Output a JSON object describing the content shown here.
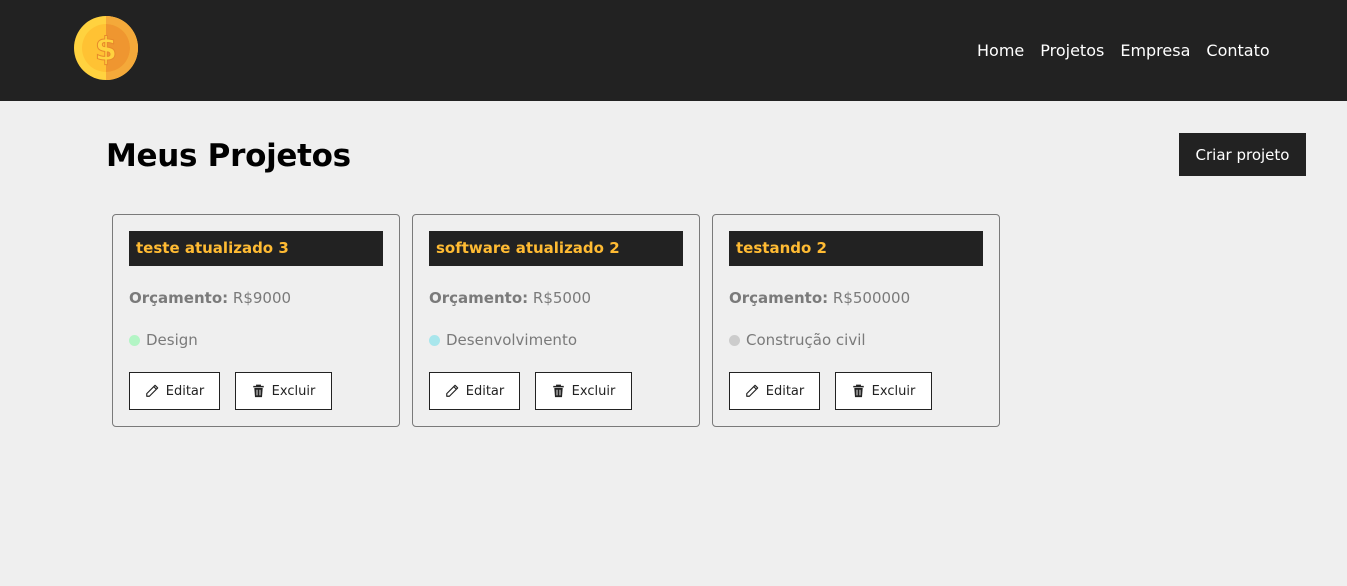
{
  "brand": {
    "logo_icon": "dollar-coin-icon"
  },
  "nav": {
    "items": [
      "Home",
      "Projetos",
      "Empresa",
      "Contato"
    ]
  },
  "main": {
    "title": "Meus Projetos",
    "create_button": "Criar projeto"
  },
  "colors": {
    "dark": "#222222",
    "title_accent": "#ffbb33",
    "text_muted": "#7a7a7a"
  },
  "projects": [
    {
      "name": "teste atualizado 3",
      "budget_label": "Orçamento:",
      "budget": "R$9000",
      "category": "Design",
      "category_color": "#b3f5c5",
      "edit_label": "Editar",
      "delete_label": "Excluir"
    },
    {
      "name": "software atualizado 2",
      "budget_label": "Orçamento:",
      "budget": "R$5000",
      "category": "Desenvolvimento",
      "category_color": "#a8e6ec",
      "edit_label": "Editar",
      "delete_label": "Excluir"
    },
    {
      "name": "testando 2",
      "budget_label": "Orçamento:",
      "budget": "R$500000",
      "category": "Construção civil",
      "category_color": "#cccccc",
      "edit_label": "Editar",
      "delete_label": "Excluir"
    }
  ]
}
